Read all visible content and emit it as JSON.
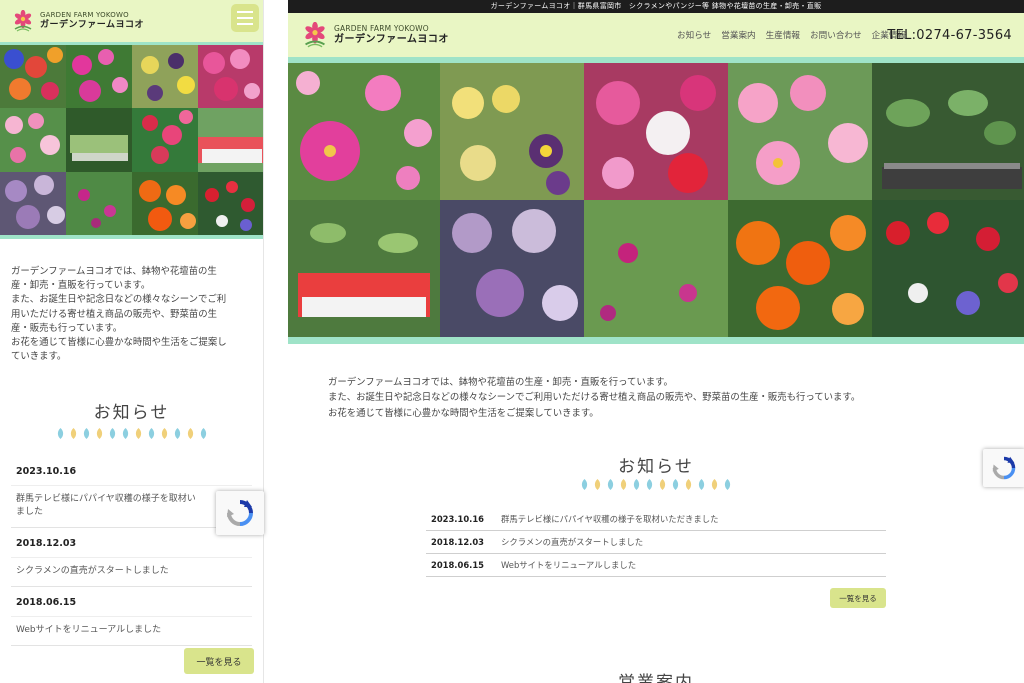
{
  "brand": {
    "name_en": "GARDEN FARM YOKOWO",
    "name_ja": "ガーデンファームヨコオ"
  },
  "top_bar": {
    "text": "ガーデンファームヨコオ｜群馬県富岡市　シクラメンやパンジー等 鉢物や花壇苗の生産・卸売・直販"
  },
  "nav": {
    "items": [
      {
        "label": "お知らせ"
      },
      {
        "label": "営業案内"
      },
      {
        "label": "生産情報"
      },
      {
        "label": "お問い合わせ"
      },
      {
        "label": "企業情報"
      }
    ],
    "tel": "TEL:0274-67-3564"
  },
  "intro": {
    "mobile_lines": [
      "ガーデンファームヨコオでは、鉢物や花壇苗の生",
      "産・卸売・直販を行っています。",
      "また、お誕生日や記念日などの様々なシーンでご利",
      "用いただける寄せ植え商品の販売や、野菜苗の生",
      "産・販売も行っています。",
      "お花を通じて皆様に心豊かな時間や生活をご提案し",
      "ていきます。"
    ],
    "desktop_lines": [
      "ガーデンファームヨコオでは、鉢物や花壇苗の生産・卸売・直販を行っています。",
      "また、お誕生日や記念日などの様々なシーンでご利用いただける寄せ植え商品の販売や、野菜苗の生産・販売も行っています。",
      "お花を通じて皆様に心豊かな時間や生活をご提案していきます。"
    ]
  },
  "news": {
    "title": "お知らせ",
    "items": [
      {
        "date": "2023.10.16",
        "text": "群馬テレビ様にパパイヤ収穫の様子を取材いただきました"
      },
      {
        "date": "2018.12.03",
        "text": "シクラメンの直売がスタートしました"
      },
      {
        "date": "2018.06.15",
        "text": "Webサイトをリニューアルしました"
      }
    ],
    "mobile_first_text_lines": [
      "群馬テレビ様にパパイヤ収穫の様子を取材い",
      "ました"
    ],
    "more_label": "一覧を見る"
  },
  "next_section": {
    "title": "営業案内"
  },
  "colors": {
    "header_bg": "#e9f6c4",
    "accent_mint": "#9fe3c8",
    "button_bg": "#d9e48c",
    "top_bar_bg": "#1d1d1d"
  }
}
